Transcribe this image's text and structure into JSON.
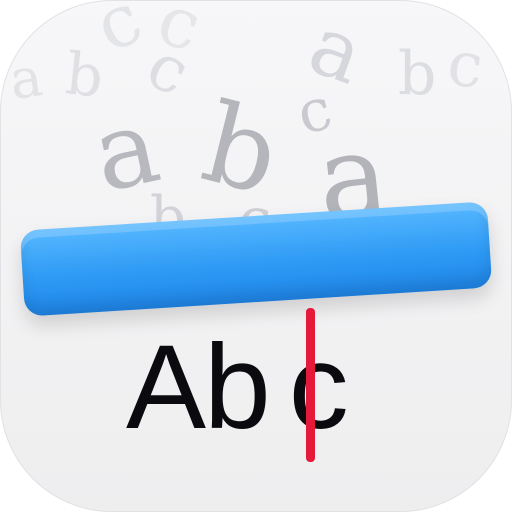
{
  "icon": {
    "background": "#f2f2f4",
    "bar_colors": [
      "#58b8ff",
      "#2f9bf5",
      "#1f87ea"
    ],
    "cursor_color": "#e5193a",
    "word_color": "#0b0b0f"
  },
  "word": {
    "part1": "Ab",
    "part2": "c"
  },
  "floating_letters": [
    {
      "text": "a"
    },
    {
      "text": "b"
    },
    {
      "text": "c"
    },
    {
      "text": "a"
    },
    {
      "text": "b"
    },
    {
      "text": "c"
    },
    {
      "text": "a"
    },
    {
      "text": "b"
    },
    {
      "text": "c"
    },
    {
      "text": "a"
    },
    {
      "text": "b"
    },
    {
      "text": "c"
    },
    {
      "text": "a"
    },
    {
      "text": "b"
    },
    {
      "text": "c"
    },
    {
      "text": "c"
    }
  ]
}
